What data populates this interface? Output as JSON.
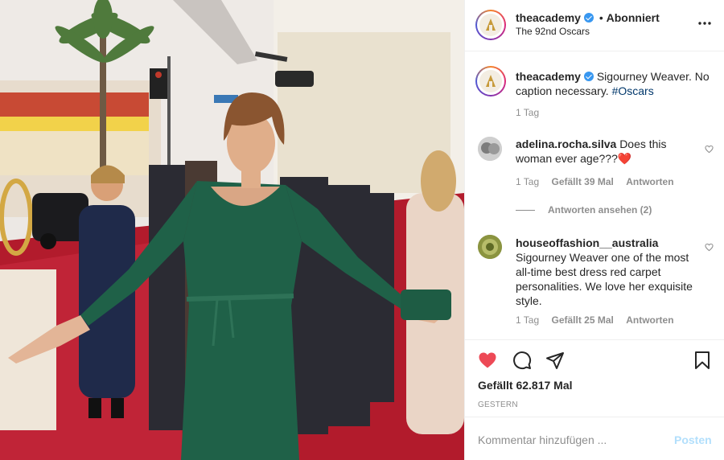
{
  "header": {
    "username": "theacademy",
    "separator": "•",
    "follow_status": "Abonniert",
    "location": "The 92nd Oscars",
    "more_icon": "more-horizontal-icon"
  },
  "caption": {
    "username": "theacademy",
    "text": "Sigourney Weaver. No caption necessary.",
    "hashtag": "#Oscars",
    "time": "1 Tag"
  },
  "comments": [
    {
      "username": "adelina.rocha.silva",
      "text": "Does this woman ever age???",
      "emoji": "❤️",
      "time": "1 Tag",
      "likes": "Gefällt 39 Mal",
      "reply": "Antworten",
      "view_replies": "Antworten ansehen (2)"
    },
    {
      "username": "houseoffashion__australia",
      "text": "Sigourney Weaver one of the most all-time best dress red carpet personalities. We love her exquisite style.",
      "time": "1 Tag",
      "likes": "Gefällt 25 Mal",
      "reply": "Antworten"
    }
  ],
  "actions": {
    "like_icon": "heart-filled-icon",
    "comment_icon": "comment-icon",
    "share_icon": "paper-plane-icon",
    "save_icon": "bookmark-icon",
    "likes_count": "Gefällt 62.817 Mal",
    "date": "GESTERN"
  },
  "add_comment": {
    "placeholder": "Kommentar hinzufügen ...",
    "post_label": "Posten"
  },
  "colors": {
    "like_red": "#ed4956",
    "verified_blue": "#3897f0",
    "link_blue": "#00376b",
    "post_disabled": "#b2dffc",
    "muted_gray": "#8e8e8e"
  }
}
